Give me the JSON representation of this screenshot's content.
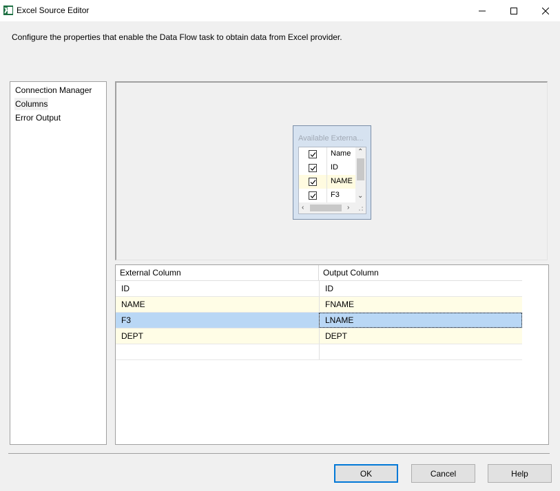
{
  "window": {
    "title": "Excel Source Editor",
    "app_icon": "excel-icon"
  },
  "description": "Configure the properties that enable the Data Flow task to obtain data from Excel provider.",
  "nav": {
    "items": [
      {
        "label": "Connection Manager"
      },
      {
        "label": "Columns",
        "selected": true
      },
      {
        "label": "Error Output"
      }
    ]
  },
  "available_columns": {
    "title": "Available Externa...",
    "header": "Name",
    "rows": [
      {
        "name": "ID",
        "checked": true
      },
      {
        "name": "NAME",
        "checked": true,
        "highlighted": true
      },
      {
        "name": "F3",
        "checked": true
      }
    ]
  },
  "mapping": {
    "headers": [
      "External Column",
      "Output Column"
    ],
    "rows": [
      {
        "external": "ID",
        "output": "ID",
        "style": "normal"
      },
      {
        "external": "NAME",
        "output": "FNAME",
        "style": "yellow"
      },
      {
        "external": "F3",
        "output": "LNAME",
        "style": "selected"
      },
      {
        "external": "DEPT",
        "output": "DEPT",
        "style": "yellow"
      },
      {
        "external": "",
        "output": "",
        "style": "normal"
      }
    ]
  },
  "buttons": {
    "ok": "OK",
    "cancel": "Cancel",
    "help": "Help"
  },
  "colors": {
    "selected_row": "#b9d7f5",
    "highlight_row": "#fffde6",
    "default_button_border": "#0078d7"
  }
}
